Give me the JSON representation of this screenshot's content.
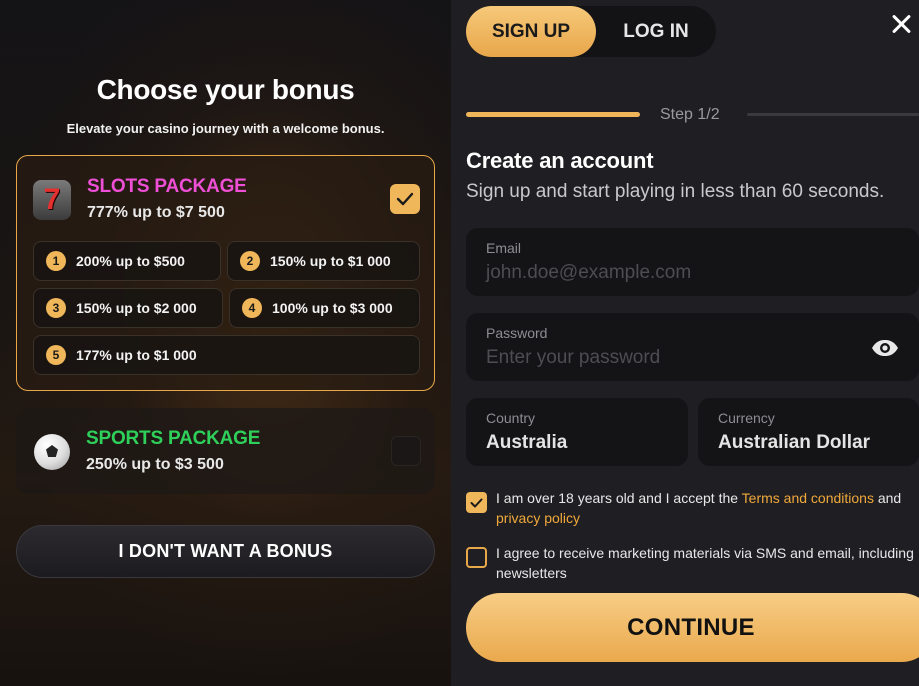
{
  "bonus_panel": {
    "title": "Choose your bonus",
    "subtitle": "Elevate your casino journey with a welcome bonus.",
    "slots": {
      "name": "SLOTS PACKAGE",
      "amount": "777% up to $7 500",
      "icon_text": "7",
      "selected": true,
      "tiers": [
        {
          "num": "1",
          "label": "200% up to $500"
        },
        {
          "num": "2",
          "label": "150% up to $1 000"
        },
        {
          "num": "3",
          "label": "150% up to $2 000"
        },
        {
          "num": "4",
          "label": "100% up to $3 000"
        },
        {
          "num": "5",
          "label": "177% up to $1 000"
        }
      ]
    },
    "sports": {
      "name": "SPORTS PACKAGE",
      "amount": "250% up to $3 500",
      "selected": false
    },
    "no_bonus_label": "I DON'T WANT A BONUS"
  },
  "auth": {
    "tabs": {
      "signup": "SIGN UP",
      "login": "LOG IN",
      "active": "signup"
    },
    "step_label": "Step 1/2",
    "heading": "Create an account",
    "subheading": "Sign up and start playing in less than 60 seconds.",
    "email": {
      "label": "Email",
      "placeholder": "john.doe@example.com"
    },
    "password": {
      "label": "Password",
      "placeholder": "Enter your password"
    },
    "country": {
      "label": "Country",
      "value": "Australia"
    },
    "currency": {
      "label": "Currency",
      "value": "Australian Dollar"
    },
    "terms": {
      "checked": true,
      "text_before": "I am over 18 years old and I accept the ",
      "terms_link": "Terms and conditions",
      "text_mid": " and ",
      "privacy_link": "privacy policy"
    },
    "marketing": {
      "checked": false,
      "text": "I agree to receive marketing materials via SMS and email, including newsletters"
    },
    "continue_label": "CONTINUE"
  },
  "colors": {
    "accent": "#f0b75a",
    "slots_name": "#ee4fd6",
    "sports_name": "#2fd05a",
    "link": "#f0a93a",
    "panel_bg": "#1f1e22",
    "field_bg": "#141316"
  }
}
